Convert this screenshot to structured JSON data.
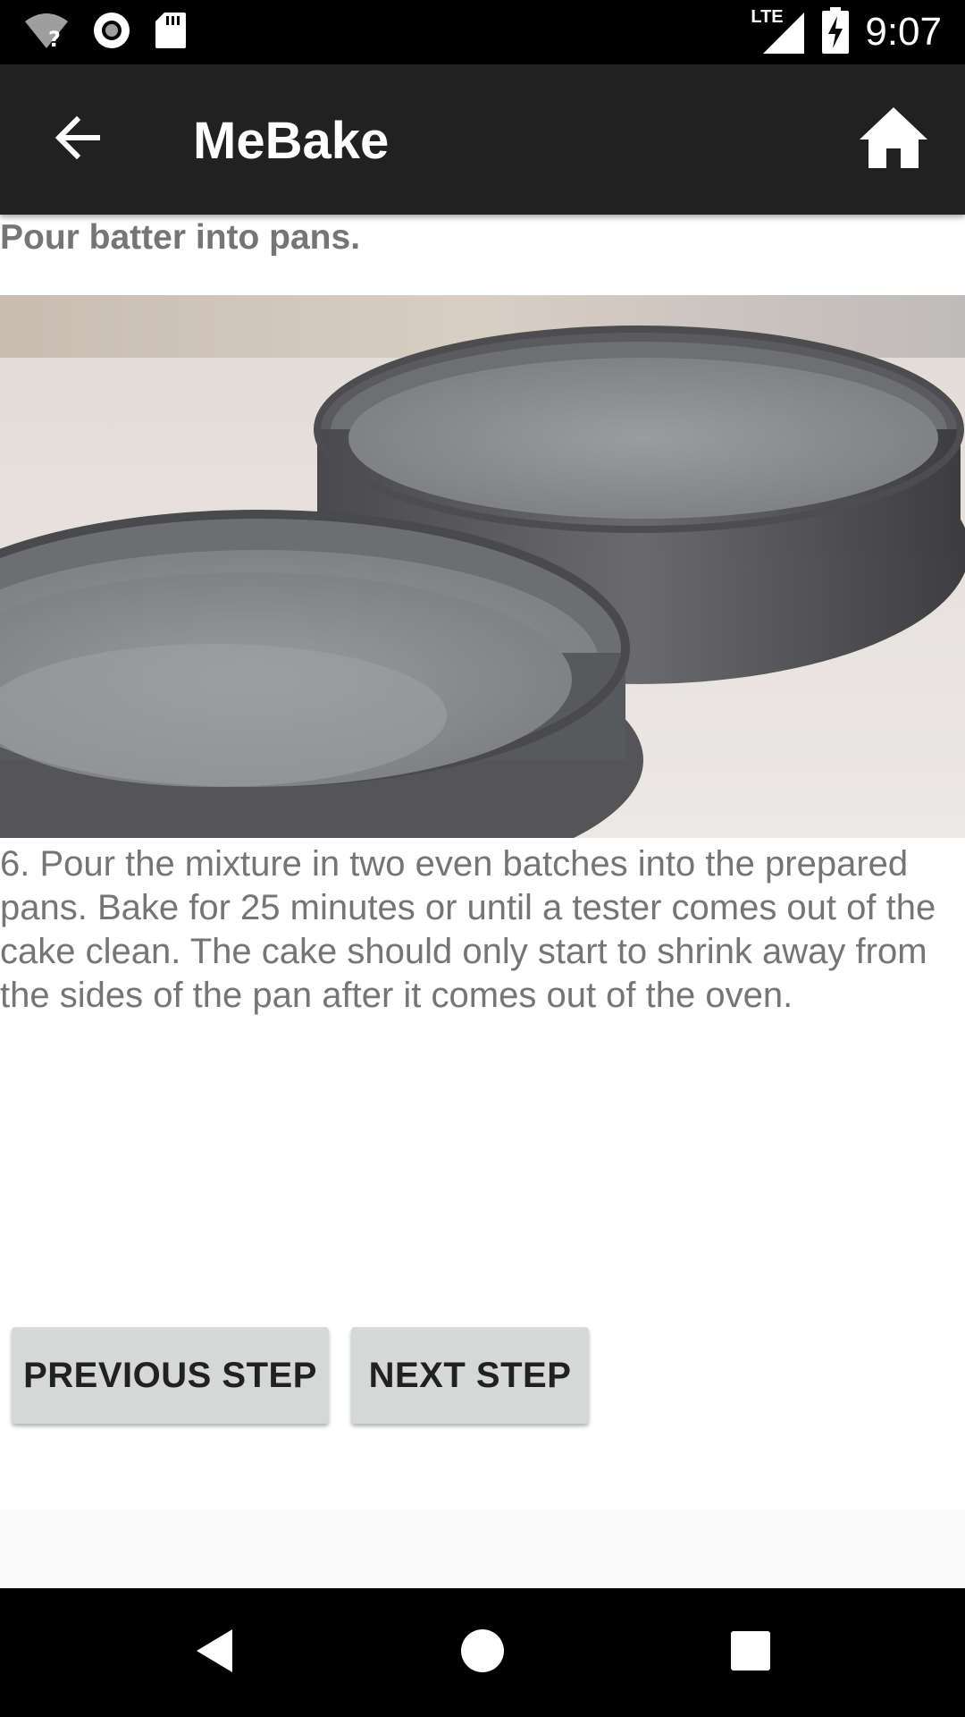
{
  "status_bar": {
    "time": "9:07",
    "network_label": "LTE",
    "icons": [
      "wifi-unknown-icon",
      "record-icon",
      "sd-card-icon",
      "lte-signal-icon",
      "battery-charging-icon"
    ]
  },
  "app_bar": {
    "title": "MeBake",
    "back_icon": "arrow-left-icon",
    "home_icon": "home-icon"
  },
  "step": {
    "title": "Pour batter into pans.",
    "image_description_icon": "cake-pans-photo",
    "description": "6. Pour the mixture in two even batches into the prepared pans. Bake for 25 minutes or until a tester comes out of the cake clean. The cake should only start to shrink away from the sides of the pan after it comes out of the oven."
  },
  "buttons": {
    "previous_label": "PREVIOUS STEP",
    "next_label": "NEXT STEP"
  },
  "nav_bar": {
    "icons": [
      "nav-back-icon",
      "nav-home-icon",
      "nav-recents-icon"
    ]
  },
  "colors": {
    "app_bar": "#212121",
    "status_bar": "#000000",
    "text_secondary": "#757575",
    "button_bg": "#d6d7d7"
  }
}
